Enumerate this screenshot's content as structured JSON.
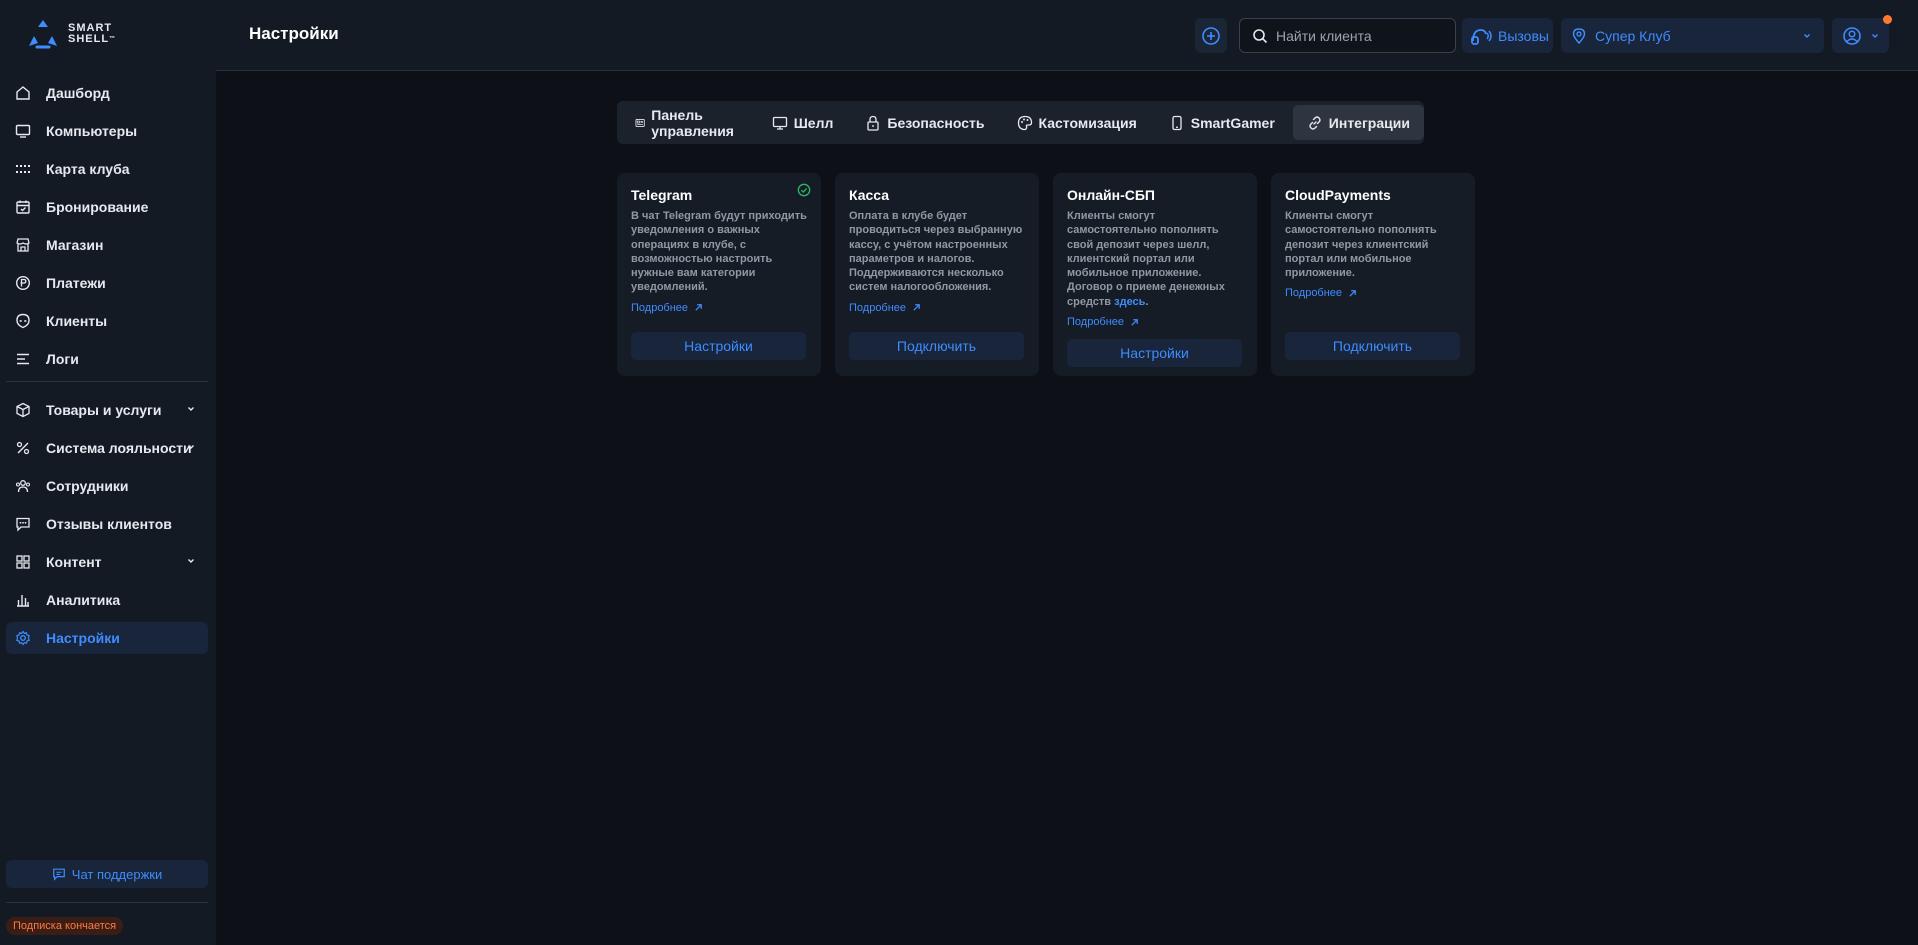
{
  "brand": {
    "line1": "SMART",
    "line2": "SHELL",
    "tm": "™"
  },
  "header": {
    "title": "Настройки",
    "search_placeholder": "Найти клиента",
    "calls_label": "Вызовы",
    "club_label": "Супер Клуб"
  },
  "sidebar": {
    "items": [
      {
        "label": "Дашборд",
        "icon": "home-icon"
      },
      {
        "label": "Компьютеры",
        "icon": "monitor-icon"
      },
      {
        "label": "Карта клуба",
        "icon": "grid-dots-icon"
      },
      {
        "label": "Бронирование",
        "icon": "calendar-icon"
      },
      {
        "label": "Магазин",
        "icon": "store-icon"
      },
      {
        "label": "Платежи",
        "icon": "ruble-coin-icon"
      },
      {
        "label": "Клиенты",
        "icon": "alien-head-icon"
      },
      {
        "label": "Логи",
        "icon": "list-icon"
      },
      {
        "label": "Товары и услуги",
        "icon": "box-icon"
      },
      {
        "label": "Система лояльности",
        "icon": "percent-icon"
      },
      {
        "label": "Сотрудники",
        "icon": "users-icon"
      },
      {
        "label": "Отзывы клиентов",
        "icon": "chat-icon"
      },
      {
        "label": "Контент",
        "icon": "tiles-icon"
      },
      {
        "label": "Аналитика",
        "icon": "bar-chart-icon"
      },
      {
        "label": "Настройки",
        "icon": "gear-icon"
      }
    ],
    "support_label": "Чат поддержки",
    "subscription_badge": "Подписка кончается"
  },
  "tabs": [
    {
      "label": "Панель управления",
      "icon": "panel-icon"
    },
    {
      "label": "Шелл",
      "icon": "monitor-icon"
    },
    {
      "label": "Безопасность",
      "icon": "lock-icon"
    },
    {
      "label": "Кастомизация",
      "icon": "palette-icon"
    },
    {
      "label": "SmartGamer",
      "icon": "phone-icon"
    },
    {
      "label": "Интеграции",
      "icon": "link-icon"
    }
  ],
  "cards": [
    {
      "title": "Telegram",
      "description": "В чат Telegram будут приходить уведомления о важных операциях в клубе, с возможностью настроить нужные вам категории уведомлений.",
      "more": "Подробнее",
      "button": "Настройки",
      "status": "connected"
    },
    {
      "title": "Касса",
      "description": "Оплата в клубе будет проводиться через выбранную кассу, с учётом настроенных параметров и налогов. Поддерживаются несколько систем налогообложения.",
      "more": "Подробнее",
      "button": "Подключить"
    },
    {
      "title": "Онлайн-СБП",
      "description": "Клиенты смогут самостоятельно пополнять свой депозит через шелл, клиентский портал или мобильное приложение. Договор о приеме денежных средств",
      "description_link": "здесь",
      "description_end": ".",
      "more": "Подробнее",
      "button": "Настройки"
    },
    {
      "title": "CloudPayments",
      "description": "Клиенты смогут самостоятельно пополнять депозит через клиентский портал или мобильное приложение.",
      "more": "Подробнее",
      "button": "Подключить"
    }
  ],
  "colors": {
    "accent": "#3f8cff",
    "success": "#2fb36b",
    "warning": "#ff7a45",
    "background": "#0d1117",
    "panel": "#141a23"
  }
}
